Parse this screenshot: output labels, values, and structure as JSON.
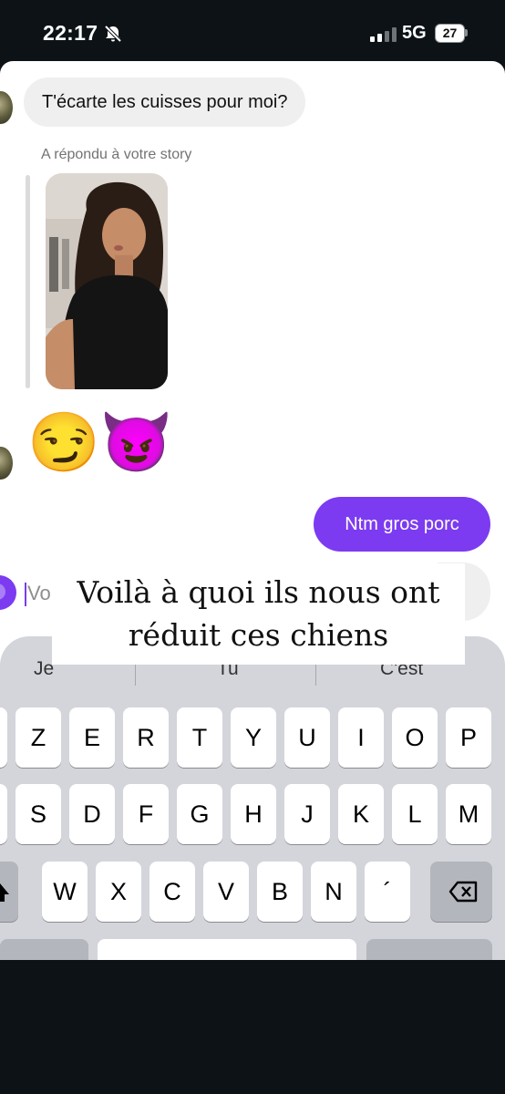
{
  "status_bar": {
    "time": "22:17",
    "network": "5G",
    "battery": "27"
  },
  "chat": {
    "incoming_message": "T'écarte les cuisses pour moi?",
    "story_reply_caption": "A répondu à votre story",
    "emojis": "😏😈",
    "outgoing_message": "Ntm gros porc"
  },
  "composer": {
    "placeholder": "Vo"
  },
  "overlay_caption": {
    "line1": "Voilà à quoi ils nous ont",
    "line2": "réduit ces chiens"
  },
  "keyboard": {
    "suggestions": [
      "Je",
      "Tu",
      "C'est"
    ],
    "row1": [
      "Z",
      "E",
      "R",
      "T",
      "Y",
      "U",
      "I",
      "O",
      "P"
    ],
    "row2": [
      "S",
      "D",
      "F",
      "G",
      "H",
      "J",
      "K",
      "L",
      "M"
    ],
    "row3": [
      "W",
      "X",
      "C",
      "V",
      "B",
      "N",
      "´"
    ]
  },
  "colors": {
    "accent": "#7c3bf0",
    "incoming_bubble": "#efefef",
    "keyboard_bg": "#d3d5db"
  }
}
